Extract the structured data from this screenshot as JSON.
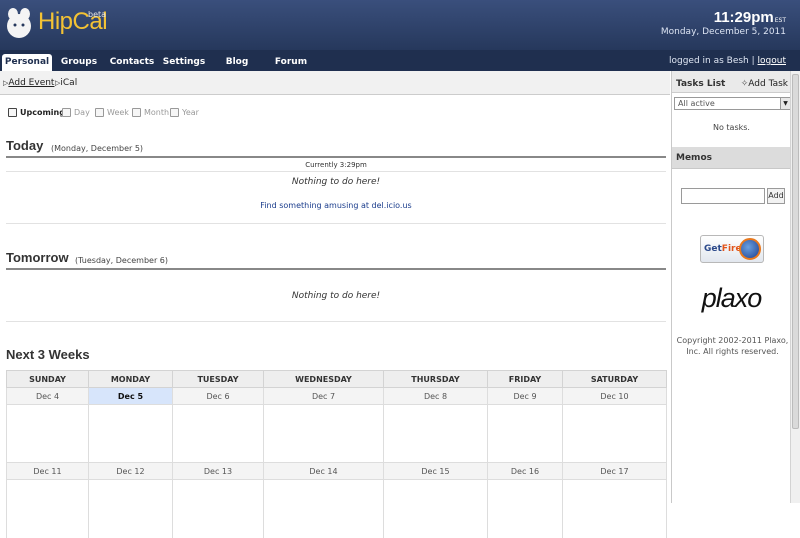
{
  "app": {
    "name": "HipCal",
    "badge": "beta"
  },
  "clock": {
    "time": "11:29pm",
    "tz": "EST",
    "date": "Monday, December 5, 2011"
  },
  "nav": {
    "tabs": [
      "Personal",
      "Groups",
      "Contacts",
      "Settings",
      "Blog",
      "Forum"
    ],
    "active": "Personal",
    "login_text": "logged in as Besh |",
    "logout": "logout"
  },
  "toolbar": {
    "add_event": "Add Event",
    "ical": "iCal"
  },
  "views": [
    {
      "label": "Upcoming",
      "icon": "upcoming-icon",
      "active": true
    },
    {
      "label": "Day",
      "icon": "day-icon",
      "active": false
    },
    {
      "label": "Week",
      "icon": "week-icon",
      "active": false
    },
    {
      "label": "Month",
      "icon": "month-icon",
      "active": false
    },
    {
      "label": "Year",
      "icon": "year-icon",
      "active": false
    }
  ],
  "today": {
    "title": "Today",
    "date": "(Monday, December 5)",
    "currently": "Currently 3:29pm",
    "nothing": "Nothing to do here!",
    "link": "Find something amusing at del.icio.us"
  },
  "tomorrow": {
    "title": "Tomorrow",
    "date": "(Tuesday, December 6)",
    "nothing": "Nothing to do here!"
  },
  "weeks": {
    "title": "Next 3 Weeks",
    "days": [
      "SUNDAY",
      "MONDAY",
      "TUESDAY",
      "WEDNESDAY",
      "THURSDAY",
      "FRIDAY",
      "SATURDAY"
    ],
    "rows": [
      [
        "Dec 4",
        "Dec 5",
        "Dec 6",
        "Dec 7",
        "Dec 8",
        "Dec 9",
        "Dec 10"
      ],
      [
        "Dec 11",
        "Dec 12",
        "Dec 13",
        "Dec 14",
        "Dec 15",
        "Dec 16",
        "Dec 17"
      ]
    ],
    "today_cell": "Dec 5"
  },
  "sidebar": {
    "tasks_title": "Tasks List",
    "add_task": "Add Task",
    "filter": "All active",
    "no_tasks": "No tasks.",
    "memos_title": "Memos",
    "memo_add": "Add",
    "firefox_a": "Get",
    "firefox_b": "Firefox",
    "plaxo": "plaxo",
    "copyright": "Copyright 2002-2011 Plaxo, Inc. All rights reserved."
  },
  "colors": {
    "header": "#2d3f66",
    "logo": "#f3c234",
    "today_highlight": "#d7e5fb"
  }
}
